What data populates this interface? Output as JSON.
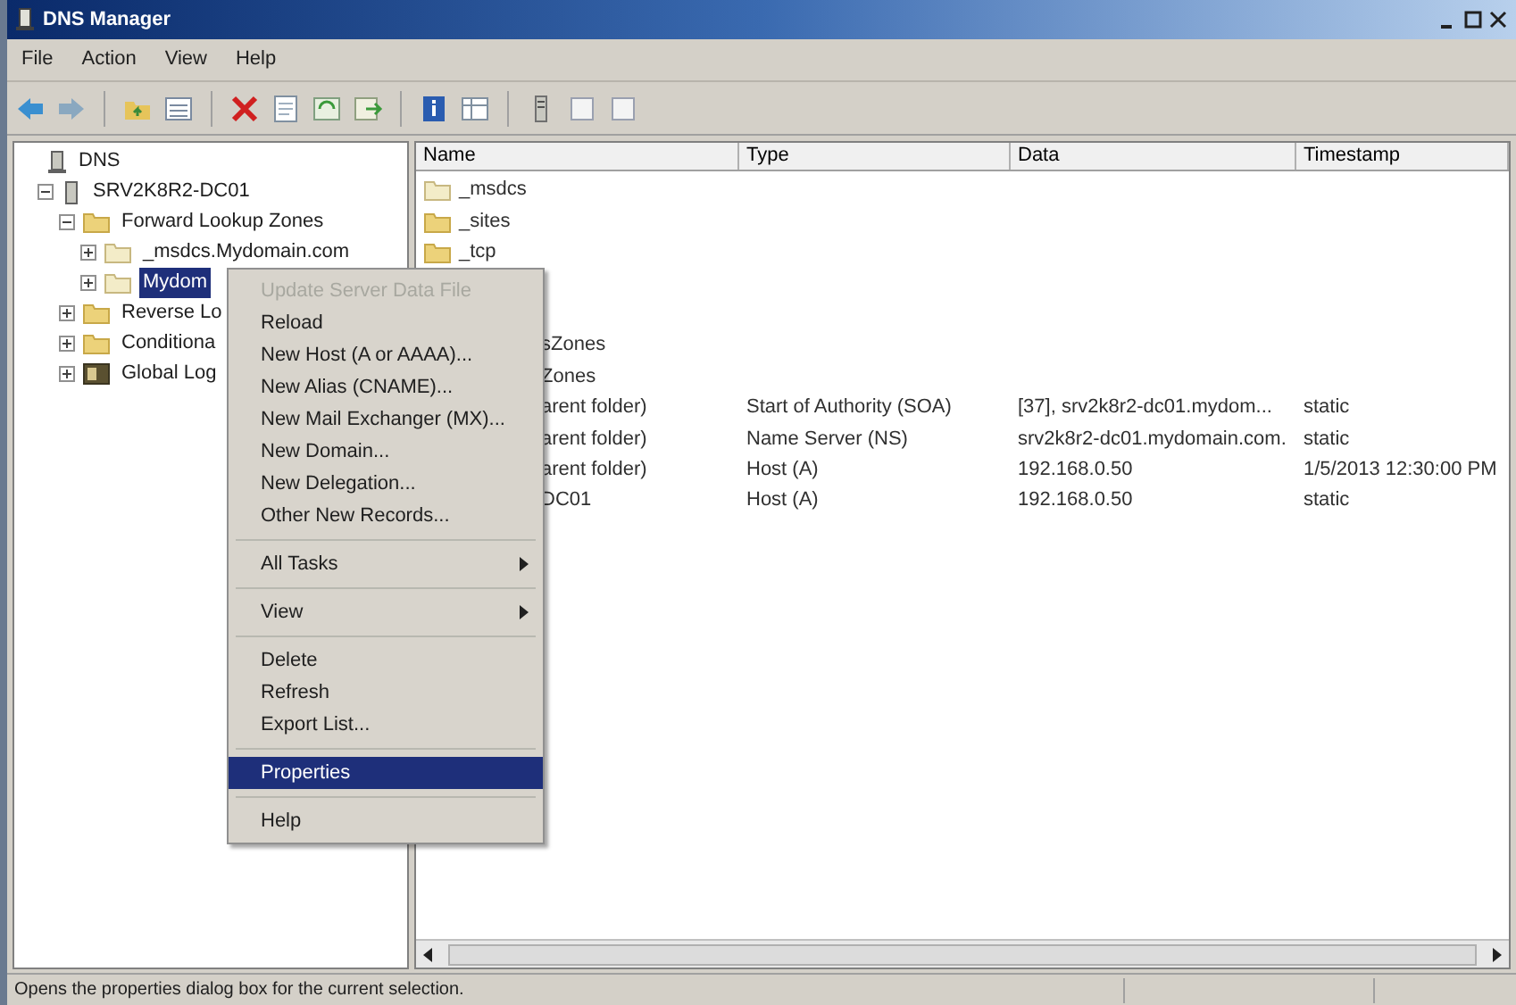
{
  "window": {
    "title": "DNS Manager"
  },
  "menu_bar": [
    "File",
    "Action",
    "View",
    "Help"
  ],
  "toolbar": [
    {
      "kind": "back"
    },
    {
      "kind": "forward"
    },
    {
      "kind": "sep"
    },
    {
      "kind": "up"
    },
    {
      "kind": "list"
    },
    {
      "kind": "sep"
    },
    {
      "kind": "delete"
    },
    {
      "kind": "properties"
    },
    {
      "kind": "refresh"
    },
    {
      "kind": "export"
    },
    {
      "kind": "sep"
    },
    {
      "kind": "help"
    },
    {
      "kind": "view"
    },
    {
      "kind": "sep"
    },
    {
      "kind": "server"
    },
    {
      "kind": "page"
    },
    {
      "kind": "page"
    }
  ],
  "tree": [
    {
      "label": "DNS",
      "kind": "dns",
      "children": [
        {
          "label": "SRV2K8R2-DC01",
          "kind": "server",
          "expanded": true,
          "children": [
            {
              "label": "Forward Lookup Zones",
              "kind": "folder",
              "expanded": true,
              "children": [
                {
                  "label": "_msdcs.Mydomain.com",
                  "kind": "zone",
                  "expanded": false,
                  "selected": false
                },
                {
                  "label": "Mydom",
                  "kind": "zone",
                  "expanded": false,
                  "selected": true
                }
              ]
            },
            {
              "label": "Reverse Lo",
              "kind": "folder",
              "expanded": false
            },
            {
              "label": "Conditiona",
              "kind": "folder",
              "expanded": false
            },
            {
              "label": "Global Log",
              "kind": "logs",
              "expanded": false
            }
          ]
        }
      ]
    }
  ],
  "table": {
    "columns": [
      "Name",
      "Type",
      "Data",
      "Timestamp"
    ],
    "rows": [
      {
        "kind": "zone",
        "name": "_msdcs"
      },
      {
        "kind": "folder",
        "name": "_sites"
      },
      {
        "kind": "folder",
        "name": "_tcp"
      },
      {
        "kind": "covered"
      },
      {
        "kind": "covered"
      },
      {
        "kind": "partial",
        "name": "sZones"
      },
      {
        "kind": "partial",
        "name": "Zones"
      },
      {
        "kind": "partial",
        "name": "arent folder)",
        "type": "Start of Authority (SOA)",
        "data": "[37], srv2k8r2-dc01.mydom...",
        "timestamp": "static"
      },
      {
        "kind": "partial",
        "name": "arent folder)",
        "type": "Name Server (NS)",
        "data": "srv2k8r2-dc01.mydomain.com.",
        "timestamp": "static"
      },
      {
        "kind": "partial",
        "name": "arent folder)",
        "type": "Host (A)",
        "data": "192.168.0.50",
        "timestamp": "1/5/2013 12:30:00 PM"
      },
      {
        "kind": "partial",
        "name": "DC01",
        "type": "Host (A)",
        "data": "192.168.0.50",
        "timestamp": "static"
      }
    ]
  },
  "context_menu": [
    {
      "kind": "item",
      "label": "Update Server Data File",
      "disabled": true,
      "selected": false
    },
    {
      "kind": "item",
      "label": "Reload",
      "disabled": false,
      "selected": false
    },
    {
      "kind": "item",
      "label": "New Host (A or AAAA)...",
      "disabled": false,
      "selected": false
    },
    {
      "kind": "item",
      "label": "New Alias (CNAME)...",
      "disabled": false,
      "selected": false
    },
    {
      "kind": "item",
      "label": "New Mail Exchanger (MX)...",
      "disabled": false,
      "selected": false
    },
    {
      "kind": "item",
      "label": "New Domain...",
      "disabled": false,
      "selected": false
    },
    {
      "kind": "item",
      "label": "New Delegation...",
      "disabled": false,
      "selected": false
    },
    {
      "kind": "item",
      "label": "Other New Records...",
      "disabled": false,
      "selected": false
    },
    {
      "kind": "sep"
    },
    {
      "kind": "submenu",
      "label": "All Tasks",
      "disabled": false,
      "selected": false
    },
    {
      "kind": "sep"
    },
    {
      "kind": "submenu",
      "label": "View",
      "disabled": false,
      "selected": false
    },
    {
      "kind": "sep"
    },
    {
      "kind": "item",
      "label": "Delete",
      "disabled": false,
      "selected": false
    },
    {
      "kind": "item",
      "label": "Refresh",
      "disabled": false,
      "selected": false
    },
    {
      "kind": "item",
      "label": "Export List...",
      "disabled": false,
      "selected": false
    },
    {
      "kind": "sep"
    },
    {
      "kind": "item",
      "label": "Properties",
      "disabled": false,
      "selected": true
    },
    {
      "kind": "sep"
    },
    {
      "kind": "item",
      "label": "Help",
      "disabled": false,
      "selected": false
    }
  ],
  "status_bar": "Opens the properties dialog box for the current selection."
}
